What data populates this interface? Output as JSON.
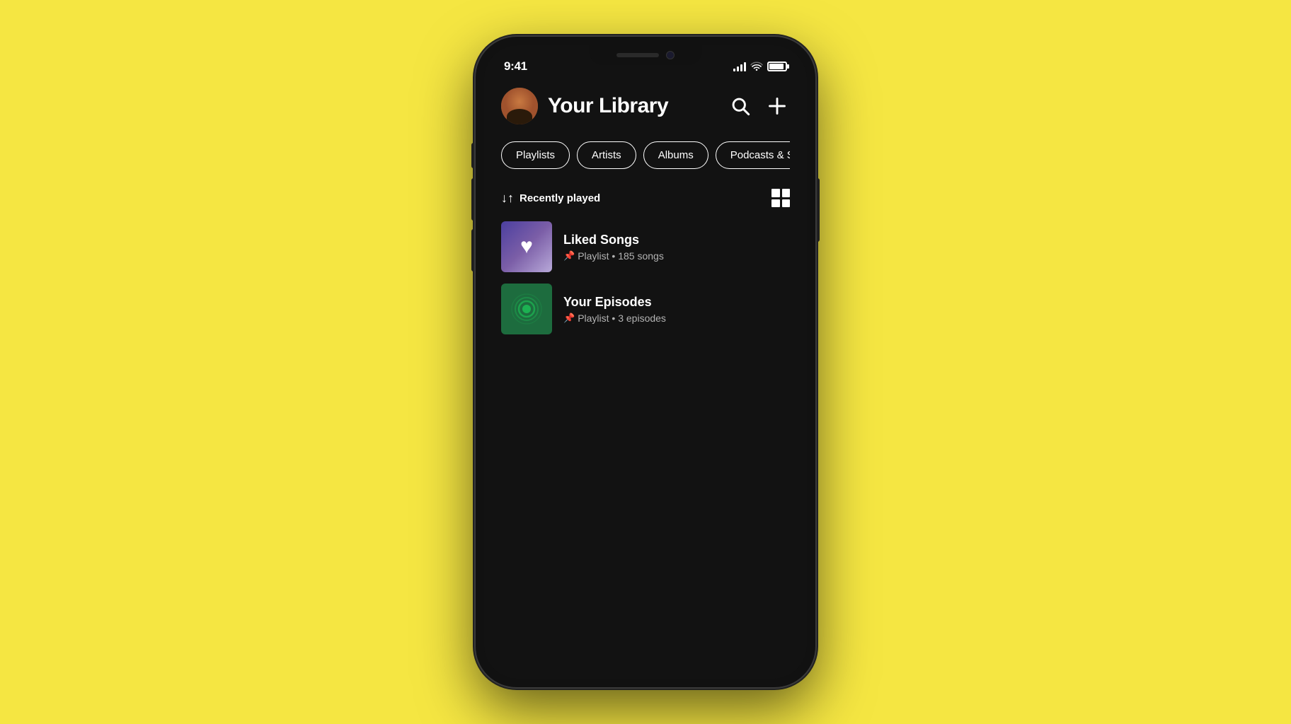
{
  "background_color": "#f5e642",
  "status_bar": {
    "time": "9:41"
  },
  "header": {
    "title": "Your Library",
    "search_label": "Search",
    "add_label": "Add"
  },
  "filters": [
    {
      "label": "Playlists",
      "active": false
    },
    {
      "label": "Artists",
      "active": false
    },
    {
      "label": "Albums",
      "active": false
    },
    {
      "label": "Podcasts & Shows",
      "active": false
    }
  ],
  "sort": {
    "label": "Recently played"
  },
  "library_items": [
    {
      "title": "Liked Songs",
      "subtitle": "Playlist • 185 songs",
      "type": "liked",
      "pinned": true
    },
    {
      "title": "Your Episodes",
      "subtitle": "Playlist • 3 episodes",
      "type": "episodes",
      "pinned": true
    }
  ]
}
